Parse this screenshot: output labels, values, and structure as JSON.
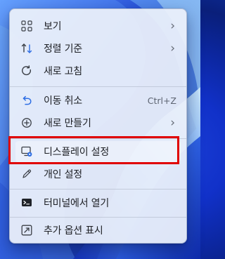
{
  "menu": {
    "items": [
      {
        "label": "보기",
        "icon": "grid-icon",
        "has_submenu": true
      },
      {
        "label": "정렬 기준",
        "icon": "sort-icon",
        "has_submenu": true
      },
      {
        "label": "새로 고침",
        "icon": "refresh-icon"
      },
      {
        "label": "이동 취소",
        "icon": "undo-icon",
        "shortcut": "Ctrl+Z"
      },
      {
        "label": "새로 만들기",
        "icon": "add-icon",
        "has_submenu": true
      },
      {
        "label": "디스플레이 설정",
        "icon": "display-settings-icon",
        "highlighted": true
      },
      {
        "label": "개인 설정",
        "icon": "pen-icon"
      },
      {
        "label": "터미널에서 열기",
        "icon": "terminal-icon"
      },
      {
        "label": "추가 옵션 표시",
        "icon": "more-options-icon"
      }
    ]
  },
  "colors": {
    "accent": "#2f6fe4",
    "highlight_border": "#e00000",
    "menu_background": "#ebf0fa"
  }
}
